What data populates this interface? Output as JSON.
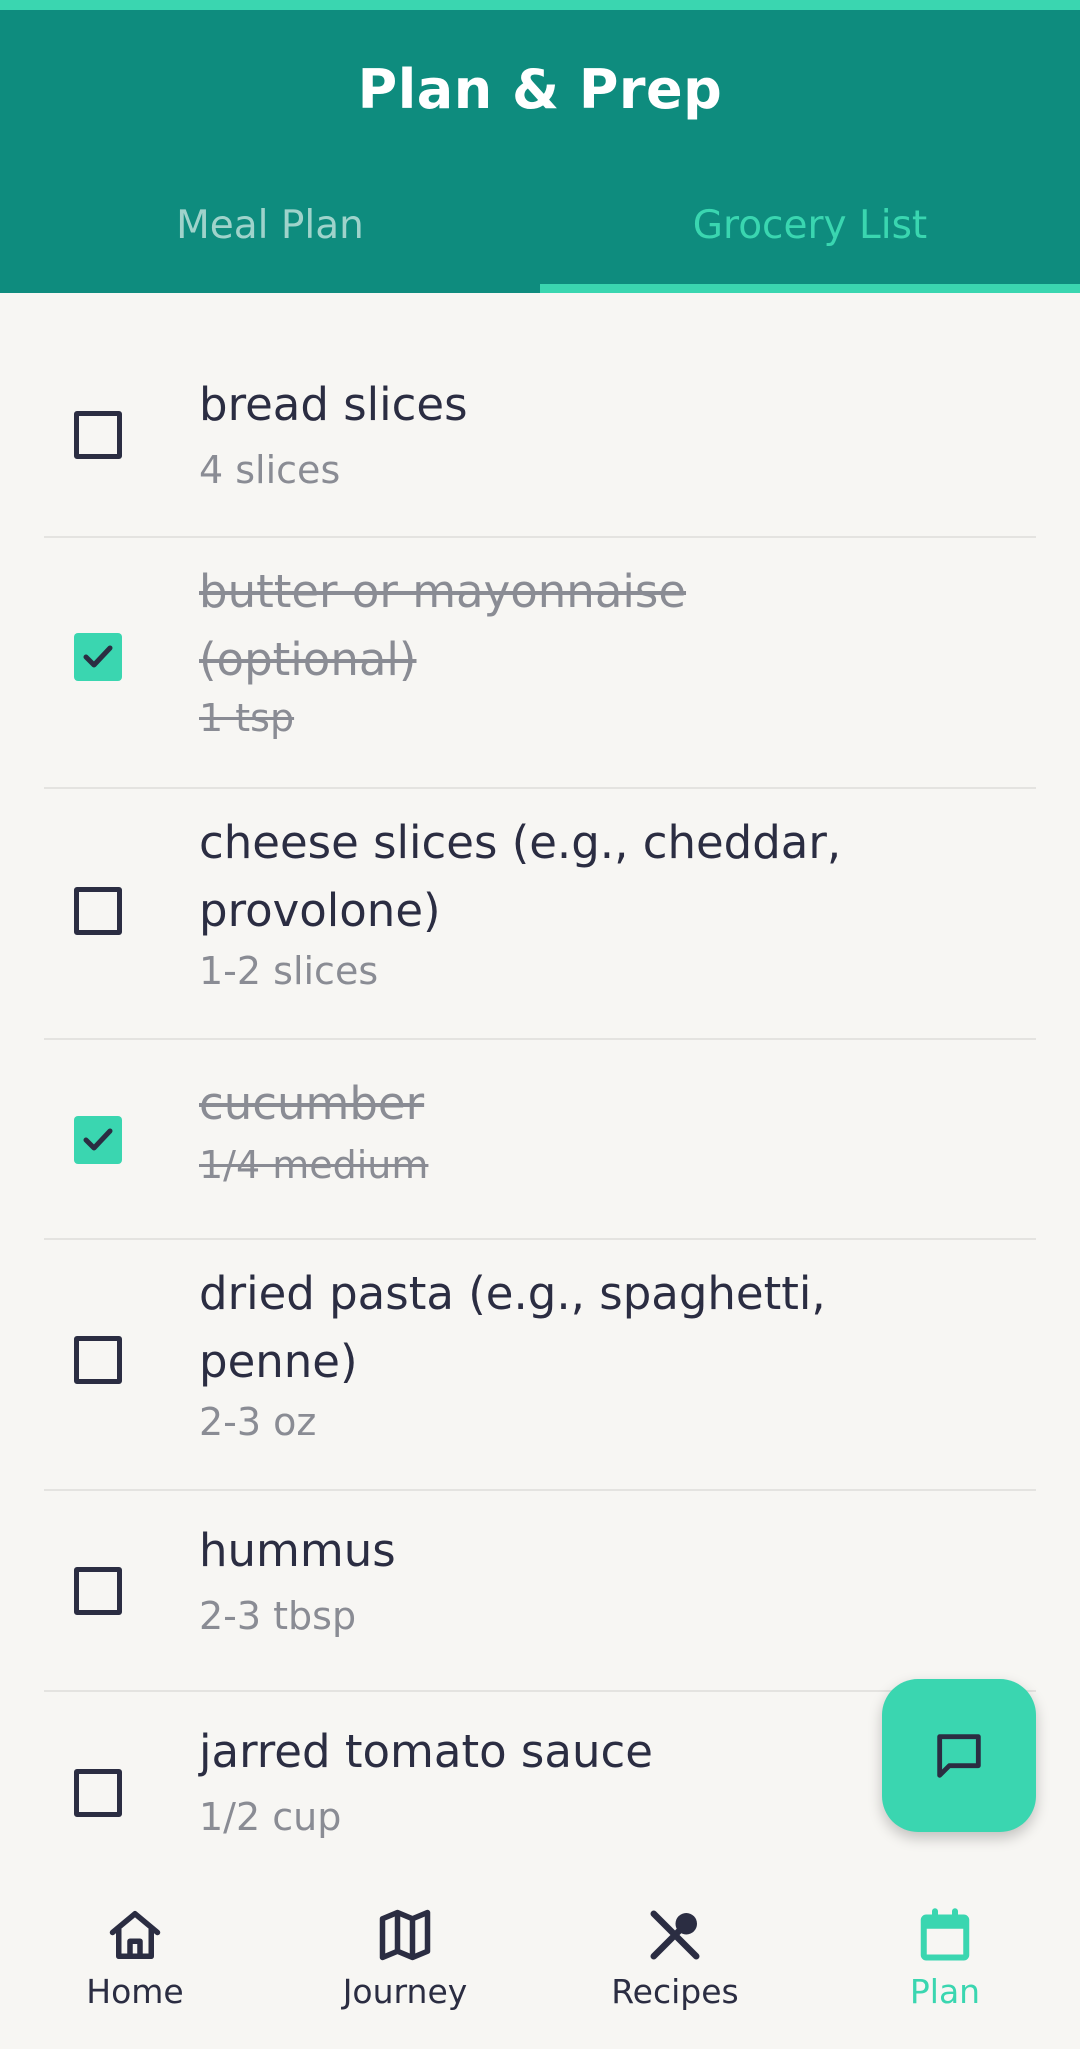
{
  "app": {
    "title": "Plan & Prep",
    "accent_color": "#3AD6B0",
    "header_color": "#0E8C7E"
  },
  "tabs": [
    {
      "label": "Meal Plan",
      "active": false
    },
    {
      "label": "Grocery List",
      "active": true
    }
  ],
  "grocery_items": [
    {
      "name": "bread slices",
      "quantity": "4 slices",
      "checked": false
    },
    {
      "name": "butter or mayonnaise (optional)",
      "quantity": "1 tsp",
      "checked": true
    },
    {
      "name": "cheese slices (e.g., cheddar, provolone)",
      "quantity": "1-2 slices",
      "checked": false
    },
    {
      "name": "cucumber",
      "quantity": "1/4 medium",
      "checked": true
    },
    {
      "name": "dried pasta (e.g., spaghetti, penne)",
      "quantity": "2-3 oz",
      "checked": false
    },
    {
      "name": "hummus",
      "quantity": "2-3 tbsp",
      "checked": false
    },
    {
      "name": "jarred tomato sauce",
      "quantity": "1/2 cup",
      "checked": false
    }
  ],
  "fab": {
    "icon": "chat-icon"
  },
  "bottom_nav": [
    {
      "label": "Home",
      "icon": "home-icon",
      "active": false
    },
    {
      "label": "Journey",
      "icon": "map-icon",
      "active": false
    },
    {
      "label": "Recipes",
      "icon": "utensils-icon",
      "active": false
    },
    {
      "label": "Plan",
      "icon": "calendar-icon",
      "active": true
    }
  ]
}
